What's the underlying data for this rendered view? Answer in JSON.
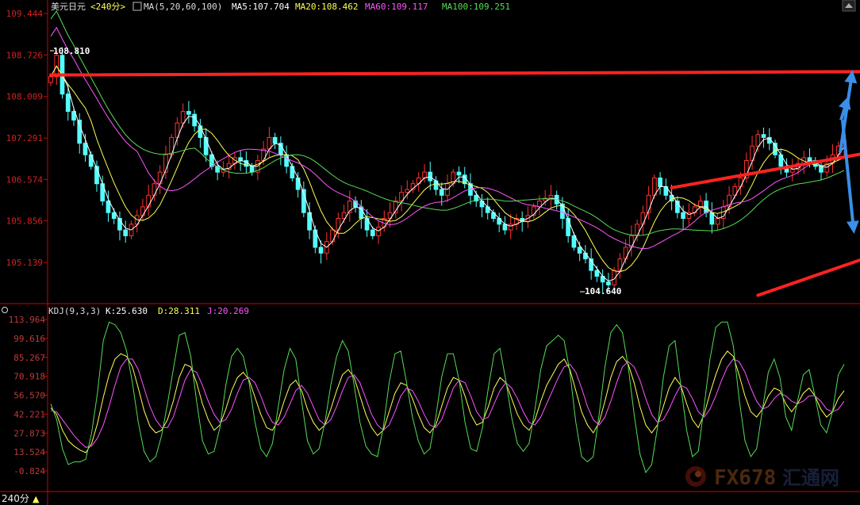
{
  "main_panel": {
    "symbol": "美元日元",
    "period": "<240分>",
    "ma_label": "MA(5,20,60,100)",
    "ma5_label": "MA5:107.704",
    "ma20_label": "MA20:108.462",
    "ma60_label": "MA60:109.117",
    "ma100_label": "MA100:109.251",
    "high_label": "108.810",
    "low_label": "104.640"
  },
  "kdj_panel": {
    "title": "KDJ(9,3,3)",
    "k_label": "K:25.630",
    "d_label": "D:28.311",
    "j_label": "J:20.269"
  },
  "footer": {
    "period_button": "240分",
    "arrow_glyph": "▲"
  },
  "watermark": {
    "brand": "FX678",
    "brand_cn": "汇通网"
  },
  "colors": {
    "background": "#000000",
    "axis": "#d40000",
    "price_axis_text": "#d22222",
    "kdj_axis_text": "#bf3a3a",
    "candle_up": "#ff3232",
    "candle_down": "#54ffff",
    "ma5": "#ffffff",
    "ma20": "#ffff55",
    "ma60": "#ff55ff",
    "ma100": "#55dd55",
    "k_line": "#ffffff",
    "d_line": "#ffff55",
    "j_line": "#ff55ff",
    "trend_red": "#ff2222",
    "arrow_blue": "#3a8fe8"
  },
  "chart_data": [
    {
      "type": "candlestick",
      "title": "美元日元 <240分>",
      "yticks": [
        "109.444",
        "108.726",
        "108.009",
        "107.291",
        "106.574",
        "105.856",
        "105.139"
      ],
      "ylim": [
        104.6,
        109.5
      ],
      "grid": false,
      "annotations": [
        {
          "kind": "high",
          "value": 108.81,
          "text": "108.810"
        },
        {
          "kind": "low",
          "value": 104.64,
          "text": "104.640"
        }
      ],
      "overlays": {
        "resistance_line": {
          "from": [
            0,
            108.38
          ],
          "to": [
            195,
            108.46
          ]
        },
        "channel_upper": {
          "from": [
            108,
            106.43
          ],
          "to": [
            195,
            107.97
          ]
        },
        "channel_lower": {
          "from": [
            123,
            104.57
          ],
          "to": [
            195,
            107.04
          ]
        },
        "arrow_up_target": 108.4,
        "arrow_down_target": 105.7
      },
      "candles_close": [
        108.35,
        108.72,
        108.05,
        107.75,
        107.6,
        107.2,
        107.0,
        106.8,
        106.5,
        106.2,
        106.0,
        105.9,
        105.7,
        105.6,
        105.8,
        105.95,
        106.1,
        106.3,
        106.5,
        106.7,
        107.0,
        107.3,
        107.55,
        107.75,
        107.7,
        107.5,
        107.3,
        107.0,
        106.8,
        106.7,
        106.75,
        106.85,
        106.95,
        106.9,
        106.8,
        106.7,
        106.9,
        107.1,
        107.3,
        107.2,
        107.0,
        106.8,
        106.6,
        106.4,
        106.0,
        105.7,
        105.4,
        105.3,
        105.5,
        105.7,
        105.9,
        106.0,
        106.2,
        106.1,
        105.9,
        105.7,
        105.6,
        105.75,
        105.9,
        106.0,
        106.2,
        106.35,
        106.4,
        106.5,
        106.6,
        106.7,
        106.55,
        106.4,
        106.3,
        106.5,
        106.7,
        106.65,
        106.5,
        106.3,
        106.2,
        106.1,
        106.0,
        105.9,
        105.8,
        105.7,
        105.8,
        105.9,
        105.85,
        105.95,
        106.1,
        106.2,
        106.25,
        106.3,
        106.15,
        105.9,
        105.6,
        105.4,
        105.3,
        105.2,
        105.0,
        104.9,
        104.8,
        104.75,
        105.0,
        105.2,
        105.4,
        105.6,
        105.8,
        106.0,
        106.3,
        106.6,
        106.45,
        106.3,
        106.2,
        106.0,
        105.9,
        106.0,
        106.1,
        106.2,
        106.0,
        105.8,
        105.9,
        106.1,
        106.3,
        106.45,
        106.6,
        106.9,
        107.15,
        107.35,
        107.3,
        107.2,
        107.0,
        106.8,
        106.7,
        106.75,
        106.85,
        106.95,
        106.9,
        106.8,
        106.7,
        106.85,
        107.0,
        107.15,
        107.25
      ],
      "kdj": {
        "yticks": [
          "113.964",
          "99.616",
          "85.267",
          "70.918",
          "56.570",
          "42.221",
          "27.873",
          "13.524",
          "-0.824"
        ],
        "ylim": [
          -8,
          118
        ],
        "series": [
          {
            "name": "K",
            "values": [
              47,
              42,
              30,
              22,
              18,
              15,
              13,
              20,
              35,
              55,
              72,
              84,
              88,
              86,
              78,
              62,
              45,
              33,
              28,
              30,
              38,
              52,
              70,
              80,
              78,
              66,
              50,
              38,
              30,
              34,
              46,
              60,
              70,
              74,
              68,
              55,
              42,
              32,
              30,
              38,
              52,
              64,
              68,
              60,
              46,
              36,
              30,
              34,
              46,
              60,
              72,
              76,
              70,
              56,
              42,
              32,
              26,
              30,
              44,
              58,
              66,
              64,
              54,
              42,
              32,
              28,
              34,
              48,
              62,
              70,
              68,
              56,
              42,
              34,
              36,
              48,
              62,
              70,
              66,
              54,
              42,
              34,
              30,
              38,
              52,
              64,
              72,
              80,
              84,
              76,
              60,
              44,
              34,
              28,
              36,
              52,
              70,
              82,
              86,
              80,
              66,
              48,
              34,
              28,
              34,
              48,
              62,
              70,
              64,
              50,
              38,
              32,
              42,
              58,
              72,
              84,
              90,
              86,
              72,
              56,
              44,
              40,
              46,
              56,
              62,
              60,
              50,
              44,
              50,
              58,
              62,
              56,
              46,
              40,
              44,
              54,
              60
            ]
          },
          {
            "name": "D",
            "values": [
              45,
              44,
              38,
              32,
              26,
              21,
              17,
              18,
              24,
              34,
              48,
              64,
              78,
              84,
              84,
              76,
              62,
              48,
              38,
              32,
              32,
              40,
              54,
              68,
              76,
              74,
              64,
              52,
              42,
              36,
              38,
              46,
              58,
              68,
              70,
              66,
              56,
              44,
              36,
              34,
              40,
              50,
              60,
              64,
              58,
              48,
              38,
              34,
              38,
              48,
              60,
              70,
              72,
              66,
              54,
              42,
              34,
              30,
              34,
              44,
              56,
              62,
              60,
              52,
              42,
              34,
              32,
              38,
              50,
              62,
              68,
              66,
              56,
              44,
              38,
              40,
              50,
              60,
              66,
              62,
              54,
              44,
              36,
              34,
              40,
              50,
              60,
              70,
              78,
              80,
              74,
              62,
              48,
              38,
              34,
              40,
              52,
              66,
              78,
              82,
              78,
              68,
              54,
              42,
              36,
              38,
              46,
              56,
              64,
              62,
              54,
              44,
              40,
              46,
              56,
              68,
              78,
              84,
              82,
              74,
              62,
              52,
              46,
              48,
              54,
              58,
              56,
              52,
              50,
              52,
              56,
              56,
              52,
              46,
              44,
              46,
              52
            ]
          },
          {
            "name": "J",
            "values": [
              50,
              38,
              16,
              4,
              6,
              6,
              8,
              28,
              58,
              98,
              112,
              110,
              104,
              90,
              66,
              36,
              14,
              6,
              10,
              26,
              50,
              76,
              102,
              104,
              86,
              52,
              22,
              12,
              14,
              32,
              64,
              86,
              92,
              86,
              66,
              36,
              16,
              10,
              20,
              48,
              76,
              92,
              84,
              52,
              22,
              12,
              16,
              36,
              64,
              86,
              98,
              90,
              64,
              36,
              18,
              12,
              10,
              32,
              66,
              88,
              90,
              66,
              40,
              22,
              12,
              16,
              40,
              70,
              88,
              88,
              68,
              36,
              16,
              14,
              32,
              62,
              88,
              92,
              68,
              40,
              20,
              14,
              20,
              46,
              76,
              94,
              98,
              102,
              98,
              74,
              36,
              10,
              6,
              10,
              42,
              78,
              104,
              110,
              104,
              78,
              42,
              12,
              -2,
              4,
              32,
              70,
              94,
              98,
              64,
              30,
              10,
              14,
              48,
              84,
              108,
              112,
              112,
              94,
              54,
              22,
              10,
              16,
              46,
              74,
              84,
              70,
              40,
              30,
              52,
              72,
              76,
              56,
              34,
              28,
              44,
              72,
              80
            ]
          }
        ]
      }
    }
  ]
}
